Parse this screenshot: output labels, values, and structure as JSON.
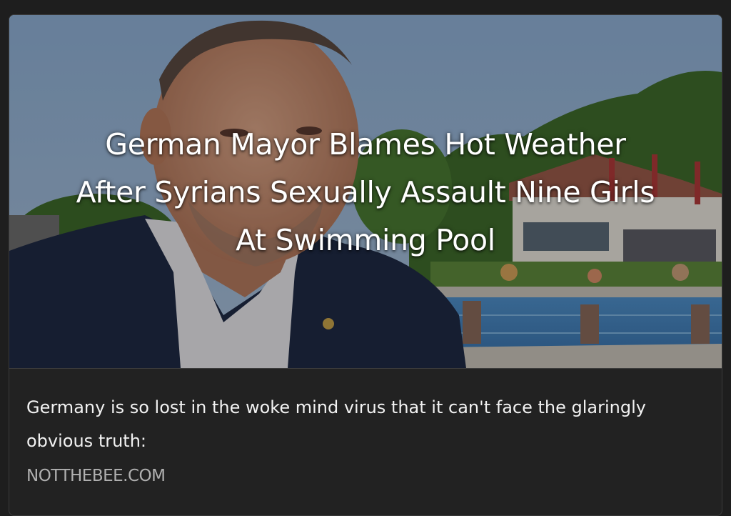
{
  "embed": {
    "headline_lines": [
      "German Mayor Blames Hot Weather",
      "After Syrians Sexually Assault Nine Girls",
      "At Swimming Pool"
    ],
    "description": "Germany is so lost in the woke mind virus that it can't face the glaringly obvious truth:",
    "source": "NOTTHEBEE.COM"
  },
  "colors": {
    "page_background": "#1e1e1e",
    "card_background": "#222222",
    "headline_text": "#ffffff",
    "description_text": "#f2f2f2",
    "source_text": "#b0b0b0"
  }
}
